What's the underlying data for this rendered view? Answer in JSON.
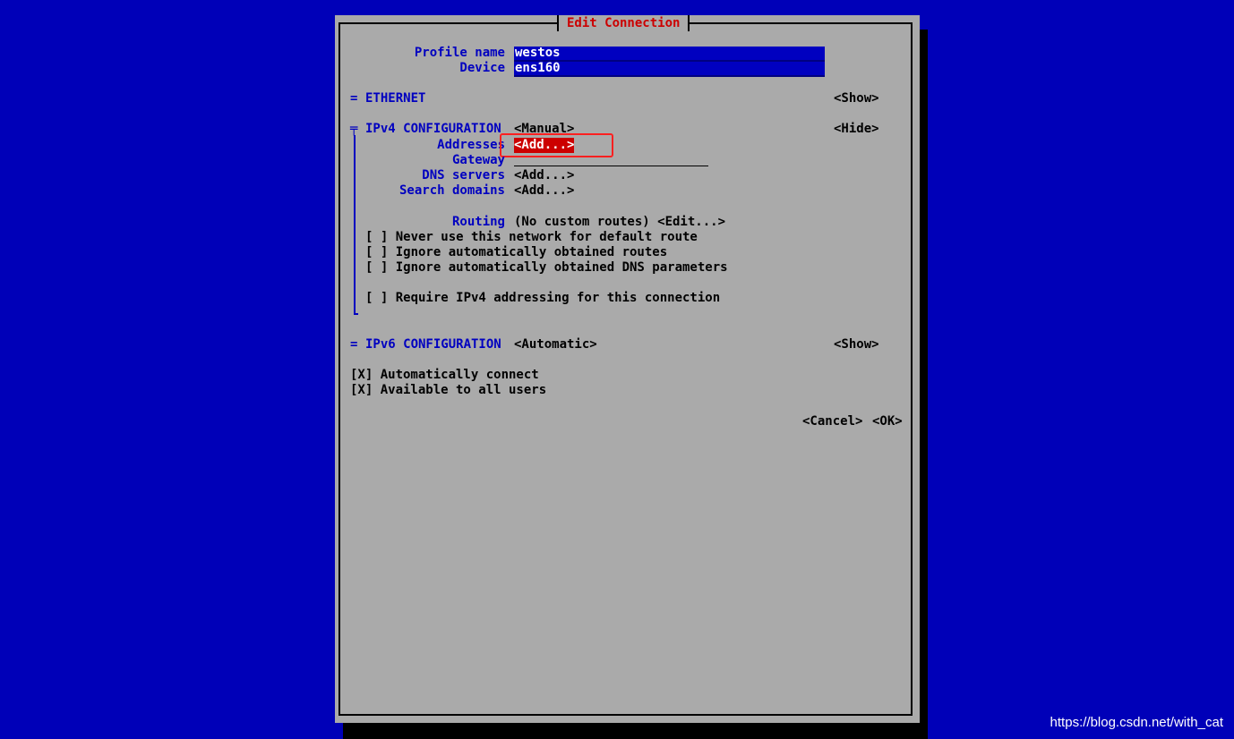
{
  "dialog": {
    "title": "Edit Connection",
    "profile_label": "Profile name",
    "profile_value": "westos",
    "device_label": "Device",
    "device_value": "ens160",
    "ethernet": {
      "marker": "=",
      "label": "ETHERNET",
      "toggle": "<Show>"
    },
    "ipv4": {
      "marker": "╤",
      "label": "IPv4 CONFIGURATION",
      "mode": "<Manual>",
      "toggle": "<Hide>",
      "addresses_label": "Addresses",
      "addresses_btn": "<Add...>",
      "gateway_label": "Gateway",
      "dns_label": "DNS servers",
      "dns_btn": "<Add...>",
      "search_label": "Search domains",
      "search_btn": "<Add...>",
      "routing_label": "Routing",
      "routing_value": "(No custom routes) <Edit...>",
      "never_default": "[ ] Never use this network for default route",
      "ignore_routes": "[ ] Ignore automatically obtained routes",
      "ignore_dns": "[ ] Ignore automatically obtained DNS parameters",
      "require_ipv4": "[ ] Require IPv4 addressing for this connection"
    },
    "ipv6": {
      "marker": "=",
      "label": "IPv6 CONFIGURATION",
      "mode": "<Automatic>",
      "toggle": "<Show>"
    },
    "auto_connect": "[X] Automatically connect",
    "all_users": "[X] Available to all users",
    "cancel_btn": "<Cancel>",
    "ok_btn": "<OK>"
  },
  "watermark": "https://blog.csdn.net/with_cat",
  "colors": {
    "background": "#0000b8",
    "dialog": "#aaaaaa",
    "label_blue": "#0000c0",
    "title_red": "#cc0000",
    "highlight": "#ff2020"
  }
}
